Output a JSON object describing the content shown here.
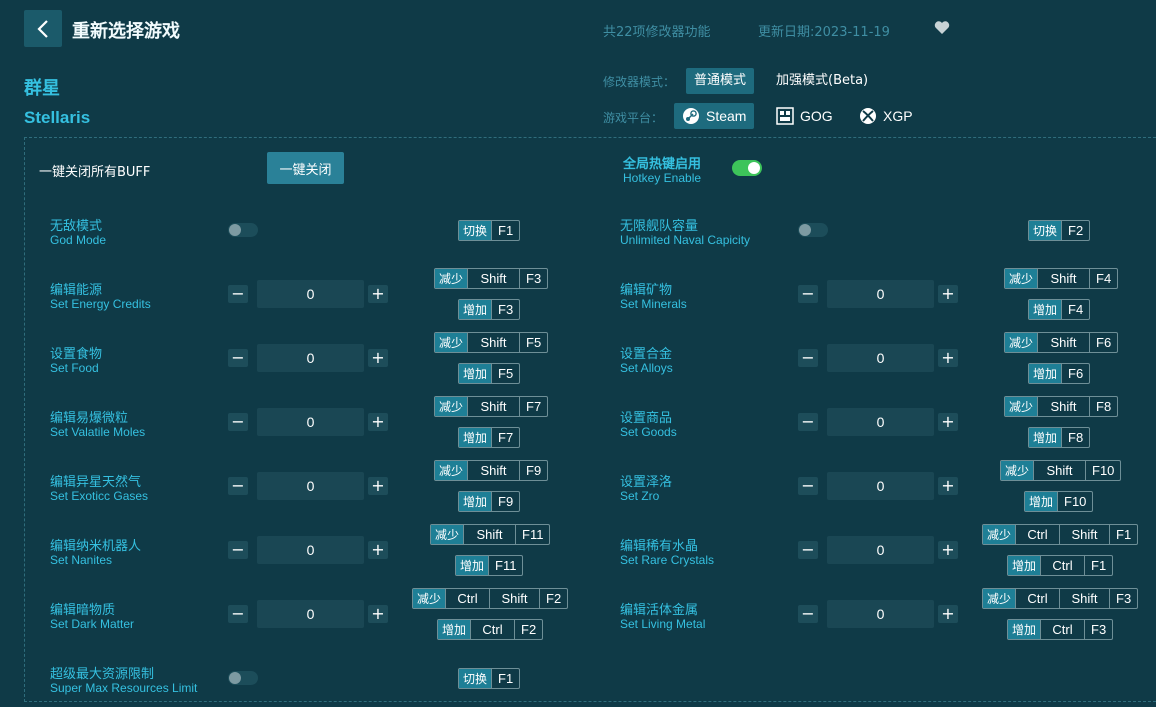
{
  "header": {
    "title": "重新选择游戏",
    "feature_count": "共22项修改器功能",
    "update_date": "更新日期:2023-11-19"
  },
  "game": {
    "name_cn": "群星",
    "name_en": "Stellaris"
  },
  "mode": {
    "label": "修改器模式：",
    "normal": "普通模式",
    "enhanced": "加强模式(Beta)"
  },
  "platform": {
    "label": "游戏平台：",
    "steam": "Steam",
    "gog": "GOG",
    "xgp": "XGP"
  },
  "master": {
    "label": "一键关闭所有BUFF",
    "button": "一键关闭"
  },
  "hotkey_enable": {
    "cn": "全局热键启用",
    "en": "Hotkey Enable"
  },
  "labels": {
    "toggle": "切换",
    "decrease": "减少",
    "increase": "增加"
  },
  "items": {
    "god_mode": {
      "cn": "无敌模式",
      "en": "God Mode",
      "key": "F1"
    },
    "naval": {
      "cn": "无限舰队容量",
      "en": "Unlimited Naval Capicity",
      "key": "F2"
    },
    "energy": {
      "cn": "编辑能源",
      "en": "Set Energy Credits",
      "value": "0",
      "dec": [
        "Shift",
        "F3"
      ],
      "inc": [
        "F3"
      ]
    },
    "minerals": {
      "cn": "编辑矿物",
      "en": "Set Minerals",
      "value": "0",
      "dec": [
        "Shift",
        "F4"
      ],
      "inc": [
        "F4"
      ]
    },
    "food": {
      "cn": "设置食物",
      "en": "Set Food",
      "value": "0",
      "dec": [
        "Shift",
        "F5"
      ],
      "inc": [
        "F5"
      ]
    },
    "alloys": {
      "cn": "设置合金",
      "en": "Set Alloys",
      "value": "0",
      "dec": [
        "Shift",
        "F6"
      ],
      "inc": [
        "F6"
      ]
    },
    "volatile": {
      "cn": "编辑易爆微粒",
      "en": "Set Valatile Moles",
      "value": "0",
      "dec": [
        "Shift",
        "F7"
      ],
      "inc": [
        "F7"
      ]
    },
    "goods": {
      "cn": "设置商品",
      "en": "Set Goods",
      "value": "0",
      "dec": [
        "Shift",
        "F8"
      ],
      "inc": [
        "F8"
      ]
    },
    "gases": {
      "cn": "编辑异星天然气",
      "en": "Set Exoticc Gases",
      "value": "0",
      "dec": [
        "Shift",
        "F9"
      ],
      "inc": [
        "F9"
      ]
    },
    "zro": {
      "cn": "设置泽洛",
      "en": "Set Zro",
      "value": "0",
      "dec": [
        "Shift",
        "F10"
      ],
      "inc": [
        "F10"
      ]
    },
    "nanites": {
      "cn": "编辑纳米机器人",
      "en": "Set Nanites",
      "value": "0",
      "dec": [
        "Shift",
        "F11"
      ],
      "inc": [
        "F11"
      ]
    },
    "crystals": {
      "cn": "编辑稀有水晶",
      "en": "Set Rare Crystals",
      "value": "0",
      "dec": [
        "Ctrl",
        "Shift",
        "F1"
      ],
      "inc": [
        "Ctrl",
        "F1"
      ]
    },
    "dark": {
      "cn": "编辑暗物质",
      "en": "Set Dark Matter",
      "value": "0",
      "dec": [
        "Ctrl",
        "Shift",
        "F2"
      ],
      "inc": [
        "Ctrl",
        "F2"
      ]
    },
    "metal": {
      "cn": "编辑活体金属",
      "en": "Set Living Metal",
      "value": "0",
      "dec": [
        "Ctrl",
        "Shift",
        "F3"
      ],
      "inc": [
        "Ctrl",
        "F3"
      ]
    },
    "supermax": {
      "cn": "超级最大资源限制",
      "en": "Super Max Resources Limit",
      "key": "F1"
    }
  },
  "colors": {
    "background": "#0f3a47",
    "accent": "#35c0e0",
    "toggle_on": "#3dc45a"
  },
  "icons": [
    "back-arrow-icon",
    "heart-icon",
    "steam-icon",
    "gog-icon",
    "xbox-icon"
  ]
}
